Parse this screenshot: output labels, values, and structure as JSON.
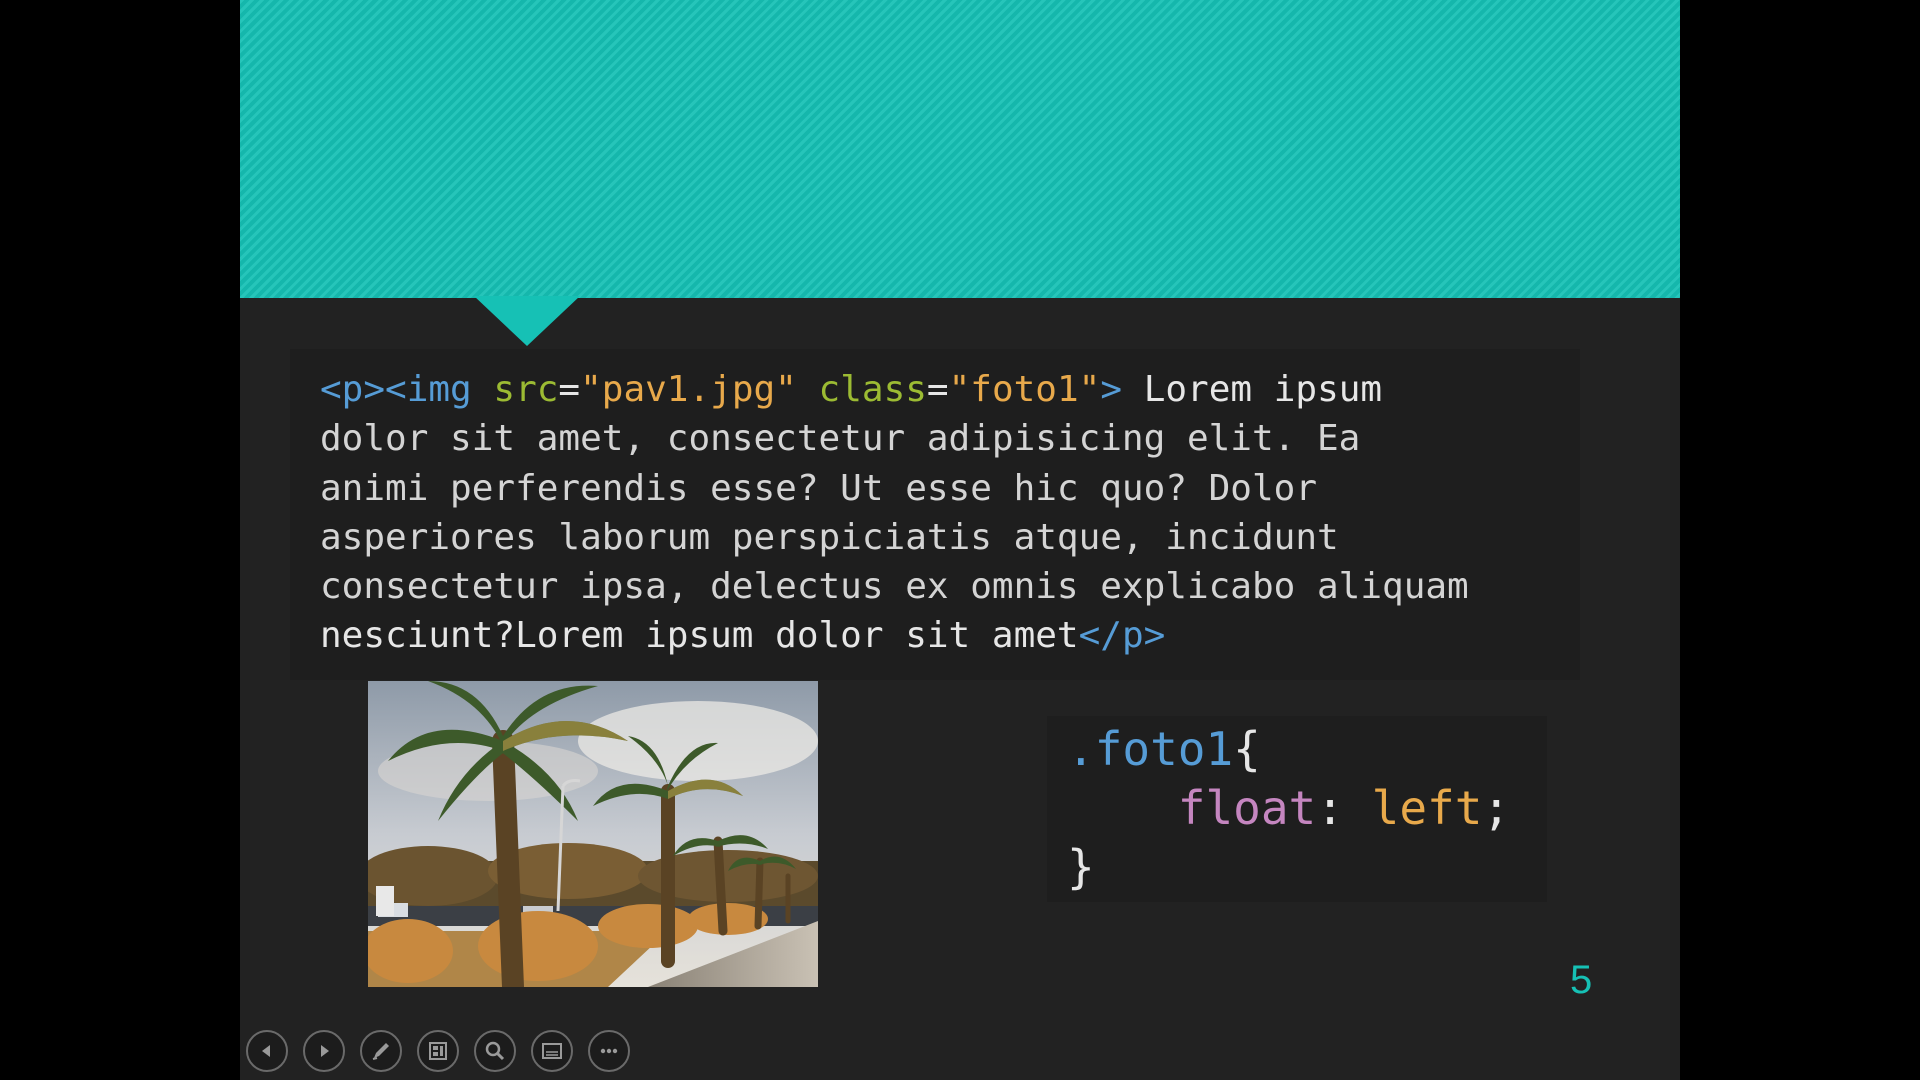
{
  "html_code": {
    "line1": [
      {
        "t": "<p><img ",
        "c": "tag"
      },
      {
        "t": "src",
        "c": "attr"
      },
      {
        "t": "=",
        "c": "plain"
      },
      {
        "t": "\"pav1.jpg\"",
        "c": "str"
      },
      {
        "t": " ",
        "c": "plain"
      },
      {
        "t": "class",
        "c": "attr"
      },
      {
        "t": "=",
        "c": "plain"
      },
      {
        "t": "\"foto1\"",
        "c": "str"
      },
      {
        "t": ">",
        "c": "tag"
      },
      {
        "t": " Lorem ipsum",
        "c": "plain"
      }
    ],
    "line2": "dolor sit amet, consectetur adipisicing elit. Ea",
    "line3": "animi perferendis esse? Ut esse hic quo? Dolor",
    "line4": "asperiores laborum perspiciatis atque, incidunt",
    "line5": "consectetur ipsa, delectus ex omnis explicabo aliquam",
    "line6_text": "nesciunt?Lorem ipsum dolor sit amet",
    "line6_tag": "</p>"
  },
  "css_code": {
    "selector": ".foto1",
    "open_brace": "{",
    "indent": "    ",
    "property": "float",
    "colon": ": ",
    "value": "left",
    "semicolon": ";",
    "close_brace": "}"
  },
  "slide_number": "5",
  "toolbar": {
    "buttons": [
      "previous-slide",
      "next-slide",
      "pen",
      "see-all-slides",
      "zoom",
      "subtitles",
      "more-options"
    ]
  },
  "colors": {
    "accent": "#16c1b5",
    "slide_background": "#222222",
    "code_background": "#1e1e1e",
    "tag": "#569cd6",
    "attribute": "#9cbb33",
    "string": "#e8a94b",
    "css_property": "#c586c0"
  },
  "icons": {
    "photo": "palm-trees-photo"
  }
}
